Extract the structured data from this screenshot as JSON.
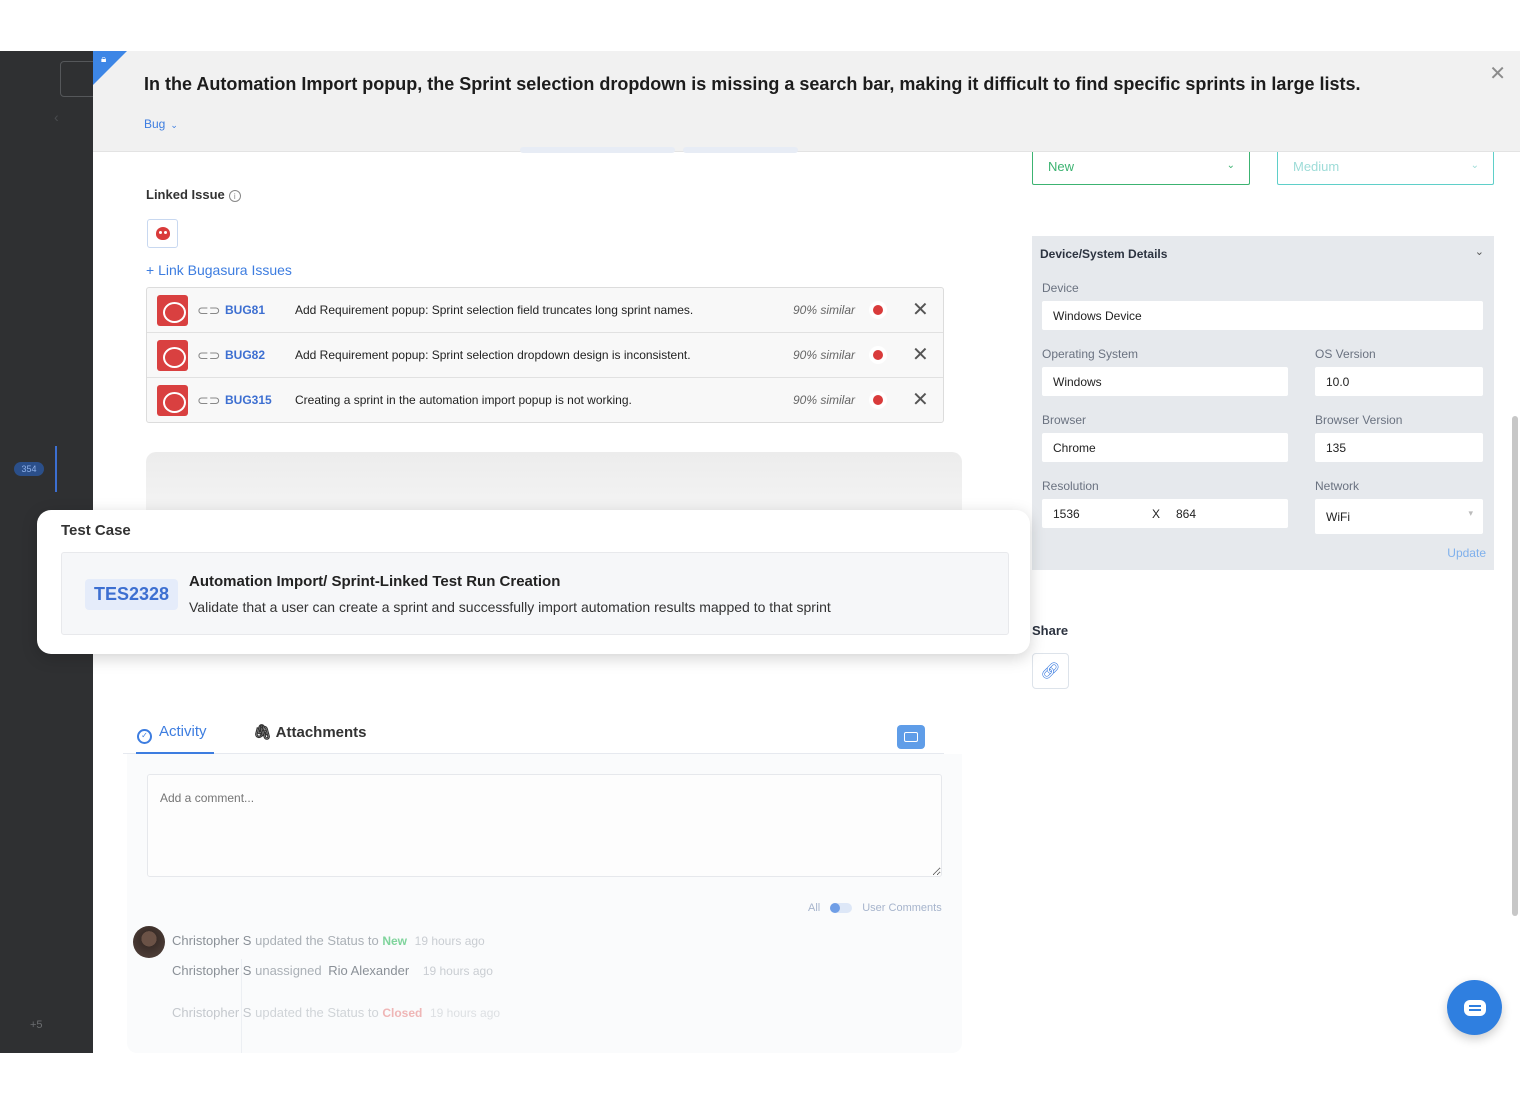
{
  "header": {
    "title": "In the Automation Import popup, the Sprint selection dropdown is missing a search bar, making it difficult to find specific sprints in large lists.",
    "type": "Bug",
    "close": "✕"
  },
  "linked": {
    "label": "Linked Issue",
    "link_text": "+ Link Bugasura Issues",
    "issues": [
      {
        "id": "BUG81",
        "text": "Add Requirement popup: Sprint selection field truncates long sprint names.",
        "similarity": "90% similar"
      },
      {
        "id": "BUG82",
        "text": "Add Requirement popup: Sprint selection dropdown design is inconsistent.",
        "similarity": "90% similar"
      },
      {
        "id": "BUG315",
        "text": "Creating a sprint in the automation import popup is not working.",
        "similarity": "90% similar"
      }
    ]
  },
  "test_case": {
    "label": "Test Case",
    "id": "TES2328",
    "title": "Automation Import/ Sprint-Linked Test Run Creation",
    "description": "Validate that a user can create a sprint and successfully import automation results mapped to that sprint"
  },
  "activity": {
    "tab_activity": "Activity",
    "tab_attachments": "Attachments",
    "comment_placeholder": "Add a comment...",
    "filter_all": "All",
    "filter_user": "User Comments",
    "entries": [
      {
        "user": "Christopher S",
        "action": "updated the Status to",
        "value": "New",
        "time": "19 hours ago"
      },
      {
        "user": "Christopher S",
        "action": "unassigned",
        "value": "Rio Alexander",
        "time": "19 hours ago"
      },
      {
        "user": "Christopher S",
        "action": "updated the Status to",
        "value": "Closed",
        "time": "19 hours ago"
      }
    ]
  },
  "status": {
    "value": "New",
    "color": "#3cb371"
  },
  "severity": {
    "value": "Medium",
    "color": "#5fcfc9"
  },
  "device": {
    "heading": "Device/System Details",
    "device_label": "Device",
    "device_value": "Windows Device",
    "os_label": "Operating System",
    "os_value": "Windows",
    "osver_label": "OS Version",
    "osver_value": "10.0",
    "browser_label": "Browser",
    "browser_value": "Chrome",
    "browserver_label": "Browser Version",
    "browserver_value": "135",
    "resolution_label": "Resolution",
    "res_w": "1536",
    "res_x": "X",
    "res_h": "864",
    "network_label": "Network",
    "network_value": "WiFi",
    "update": "Update"
  },
  "share": {
    "label": "Share"
  },
  "sidebar": {
    "count": "354",
    "more": "+5"
  }
}
